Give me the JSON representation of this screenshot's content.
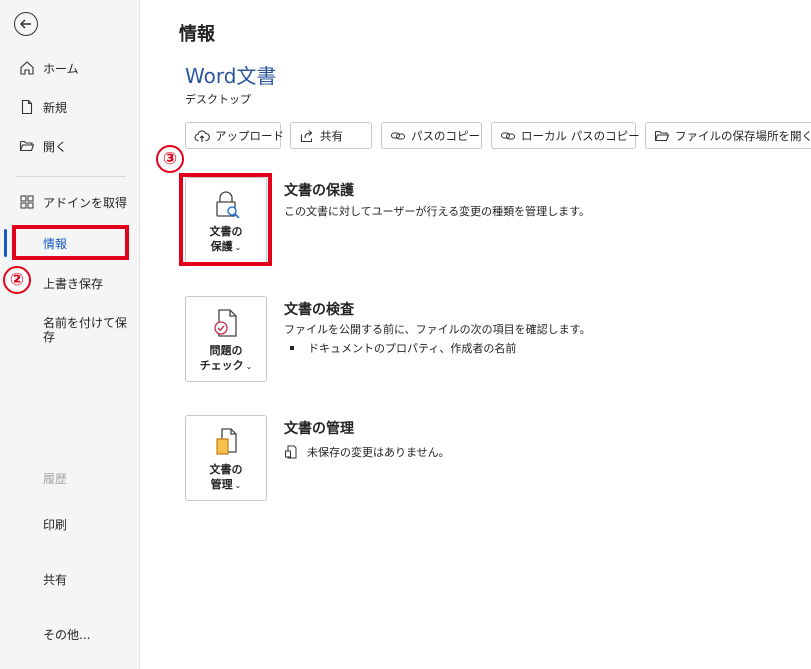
{
  "sidebar": {
    "back_label": "",
    "items": {
      "home": "ホーム",
      "new": "新規",
      "open": "開く",
      "addins": "アドインを取得",
      "info": "情報",
      "save": "上書き保存",
      "save_as": "名前を付けて保存",
      "history": "履歴",
      "print": "印刷",
      "share": "共有",
      "more": "その他..."
    }
  },
  "annotations": {
    "step2": "②",
    "step3": "③",
    "color": "#e3001b"
  },
  "main": {
    "title": "情報",
    "doc_name": "Word文書",
    "doc_location": "デスクトップ",
    "actions": {
      "upload": "アップロード",
      "share": "共有",
      "copy_path": "パスのコピー",
      "copy_local_path": "ローカル パスのコピー",
      "open_location": "ファイルの保存場所を開く"
    },
    "protect": {
      "tile_line1": "文書の",
      "tile_line2": "保護",
      "title": "文書の保護",
      "description": "この文書に対してユーザーが行える変更の種類を管理します。"
    },
    "inspect": {
      "tile_line1": "問題の",
      "tile_line2": "チェック",
      "title": "文書の検査",
      "description": "ファイルを公開する前に、ファイルの次の項目を確認します。",
      "bullet": "ドキュメントのプロパティ、作成者の名前"
    },
    "manage": {
      "tile_line1": "文書の",
      "tile_line2": "管理",
      "title": "文書の管理",
      "status": "未保存の変更はありません。"
    }
  },
  "colors": {
    "accent": "#185abd",
    "doc_name": "#2b579a",
    "sidebar_bg": "#f5f5f5"
  }
}
